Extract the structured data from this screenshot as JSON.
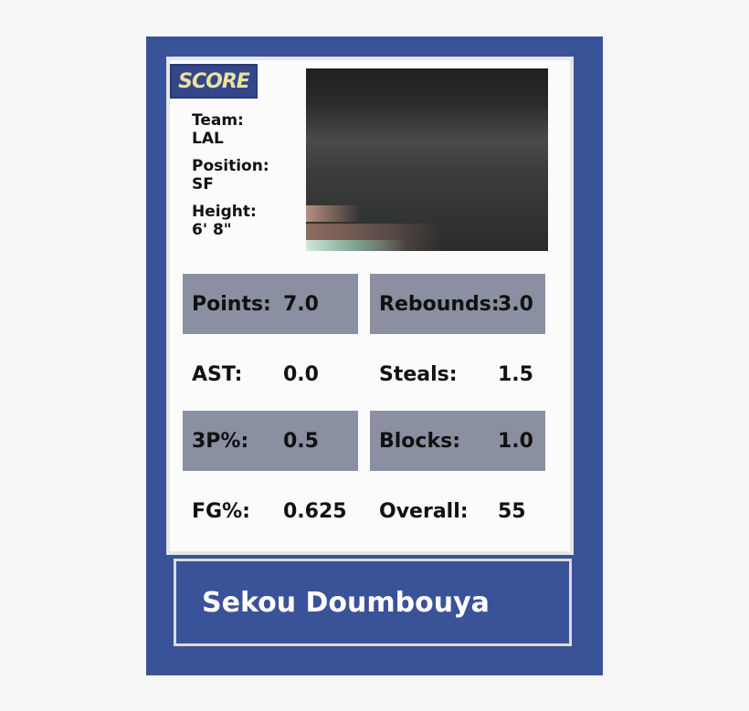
{
  "brand": {
    "logo_text": "SCORE"
  },
  "player": {
    "team_label": "Team:",
    "team": "LAL",
    "position_label": "Position:",
    "position": "SF",
    "height_label": "Height:",
    "height": "6' 8\"",
    "name": "Sekou Doumbouya"
  },
  "stats": {
    "points": {
      "label": "Points:",
      "value": "7.0"
    },
    "rebounds": {
      "label": "Rebounds:",
      "value": "3.0"
    },
    "ast": {
      "label": "AST:",
      "value": "0.0"
    },
    "steals": {
      "label": "Steals:",
      "value": "1.5"
    },
    "three_pct": {
      "label": "3P%:",
      "value": "0.5"
    },
    "blocks": {
      "label": "Blocks:",
      "value": "1.0"
    },
    "fg_pct": {
      "label": "FG%:",
      "value": "0.625"
    },
    "overall": {
      "label": "Overall:",
      "value": "55"
    }
  },
  "colors": {
    "card_border": "#3a5298",
    "stat_shade": "#8a8fa1",
    "logo_text": "#e9e2a0"
  }
}
